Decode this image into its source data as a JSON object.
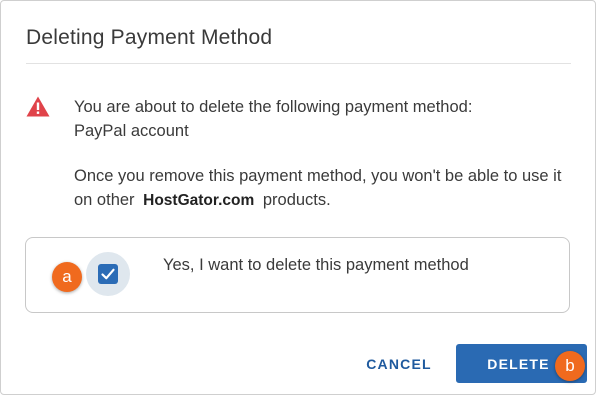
{
  "dialog": {
    "title": "Deleting Payment Method"
  },
  "message": {
    "intro": "You are about to delete the following payment method:",
    "method": "PayPal account",
    "warning_before": "Once you remove this payment method, you won't be able to use it on other",
    "brand": "HostGator.com",
    "warning_after": "products.",
    "icon": "warning-triangle-icon"
  },
  "confirm": {
    "label": "Yes, I want to delete this payment method",
    "checked": true
  },
  "actions": {
    "cancel_label": "CANCEL",
    "delete_label": "DELETE"
  },
  "callouts": {
    "a": "a",
    "b": "b"
  },
  "colors": {
    "accent": "#2a6ab3",
    "warning": "#e0434a",
    "callout": "#f06a1e"
  }
}
